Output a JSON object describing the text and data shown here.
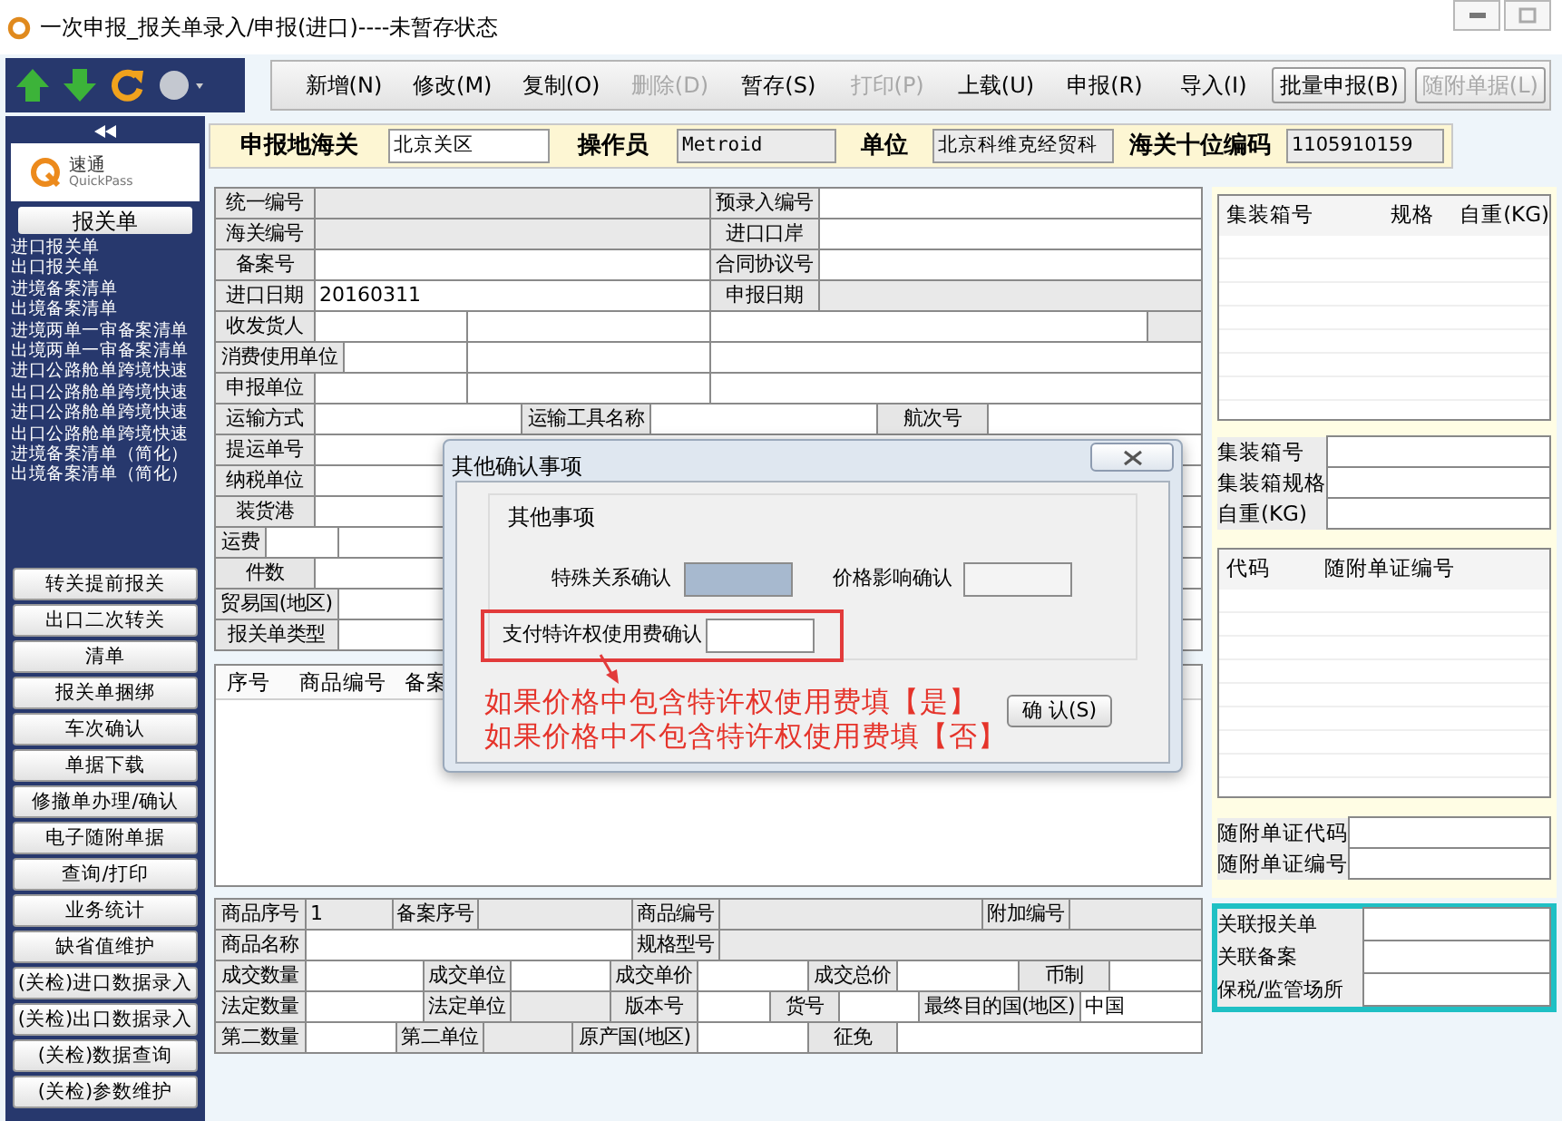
{
  "window": {
    "title": "一次申报_报关单录入/申报(进口)----未暂存状态"
  },
  "toolbar": {
    "buttons": [
      {
        "label": "新增(N)",
        "kind": "flat",
        "disabled": false
      },
      {
        "label": "修改(M)",
        "kind": "flat",
        "disabled": false
      },
      {
        "label": "复制(O)",
        "kind": "flat",
        "disabled": false
      },
      {
        "label": "删除(D)",
        "kind": "flat",
        "disabled": true
      },
      {
        "label": "暂存(S)",
        "kind": "flat",
        "disabled": false
      },
      {
        "label": "打印(P)",
        "kind": "flat",
        "disabled": true
      },
      {
        "label": "上载(U)",
        "kind": "flat",
        "disabled": false
      },
      {
        "label": "申报(R)",
        "kind": "flat",
        "disabled": false
      },
      {
        "label": "导入(I)",
        "kind": "flat",
        "disabled": false
      },
      {
        "label": "批量申报(B)",
        "kind": "raised",
        "disabled": false
      },
      {
        "label": "随附单据(L)",
        "kind": "raised",
        "disabled": true
      }
    ]
  },
  "header": {
    "fields": [
      {
        "label": "申报地海关",
        "value": "北京关区",
        "disabled": false
      },
      {
        "label": "操作员",
        "value": "Metroid",
        "disabled": true
      },
      {
        "label": "单位",
        "value": "北京科维克经贸科",
        "disabled": true
      },
      {
        "label": "海关十位编码",
        "value": "1105910159",
        "disabled": true
      }
    ]
  },
  "sidebar": {
    "logo": {
      "name": "速通",
      "subtitle": "QuickPass"
    },
    "section": "报关单",
    "links": [
      "进口报关单",
      "出口报关单",
      "进境备案清单",
      "出境备案清单",
      "进境两单一审备案清单",
      "出境两单一审备案清单",
      "进口公路舱单跨境快速",
      "出口公路舱单跨境快速",
      "进口公路舱单跨境快速",
      "出口公路舱单跨境快速",
      "进境备案清单（简化）",
      "出境备案清单（简化）"
    ],
    "buttons": [
      "转关提前报关",
      "出口二次转关",
      "清单",
      "报关单捆绑",
      "车次确认",
      "单据下载",
      "修撤单办理/确认",
      "电子随附单据",
      "查询/打印",
      "业务统计",
      "缺省值维护",
      "(关检)进口数据录入",
      "(关检)出口数据录入",
      "(关检)数据查询",
      "(关检)参数维护"
    ]
  },
  "form": {
    "rows": [
      [
        {
          "kind": "label",
          "text": "统一编号"
        },
        {
          "kind": "field",
          "disabled": true
        },
        {
          "kind": "label",
          "text": "预录入编号"
        },
        {
          "kind": "field",
          "disabled": false
        }
      ],
      [
        {
          "kind": "label",
          "text": "海关编号"
        },
        {
          "kind": "field",
          "disabled": true
        },
        {
          "kind": "label",
          "text": "进口口岸"
        },
        {
          "kind": "field",
          "disabled": false
        }
      ],
      [
        {
          "kind": "label",
          "text": "备案号"
        },
        {
          "kind": "field",
          "disabled": false
        },
        {
          "kind": "label",
          "text": "合同协议号"
        },
        {
          "kind": "field",
          "disabled": false
        }
      ],
      [
        {
          "kind": "label",
          "text": "进口日期"
        },
        {
          "kind": "field",
          "value": "20160311",
          "disabled": false
        },
        {
          "kind": "label",
          "text": "申报日期"
        },
        {
          "kind": "field",
          "disabled": true
        }
      ],
      [
        {
          "kind": "label",
          "text": "收发货人"
        },
        {
          "kind": "field",
          "disabled": false
        },
        {
          "kind": "field",
          "disabled": false
        },
        {
          "kind": "field",
          "disabled": false
        },
        {
          "kind": "field",
          "disabled": true
        }
      ],
      [
        {
          "kind": "label",
          "text": "消费使用单位"
        },
        {
          "kind": "field",
          "disabled": false
        },
        {
          "kind": "field",
          "disabled": false
        },
        {
          "kind": "field",
          "disabled": false
        }
      ],
      [
        {
          "kind": "label",
          "text": "申报单位"
        },
        {
          "kind": "field",
          "disabled": false
        },
        {
          "kind": "field",
          "disabled": false
        },
        {
          "kind": "field",
          "disabled": false
        }
      ],
      [
        {
          "kind": "label",
          "text": "运输方式"
        },
        {
          "kind": "field",
          "disabled": false
        },
        {
          "kind": "label",
          "text": "运输工具名称"
        },
        {
          "kind": "field",
          "disabled": false
        },
        {
          "kind": "label",
          "text": "航次号"
        },
        {
          "kind": "field",
          "disabled": false
        }
      ],
      [
        {
          "kind": "label",
          "text": "提运单号"
        },
        {
          "kind": "field",
          "disabled": false
        }
      ],
      [
        {
          "kind": "label",
          "text": "纳税单位"
        },
        {
          "kind": "field",
          "disabled": false
        }
      ],
      [
        {
          "kind": "label",
          "text": "装货港"
        },
        {
          "kind": "field",
          "disabled": false
        }
      ],
      [
        {
          "kind": "label",
          "text": "运费"
        },
        {
          "kind": "field",
          "disabled": false
        },
        {
          "kind": "field",
          "disabled": false
        }
      ],
      [
        {
          "kind": "label",
          "text": "件数"
        },
        {
          "kind": "field",
          "disabled": false
        }
      ],
      [
        {
          "kind": "label",
          "text": "贸易国(地区)"
        },
        {
          "kind": "field",
          "disabled": false
        }
      ],
      [
        {
          "kind": "label",
          "text": "报关单类型"
        },
        {
          "kind": "field",
          "disabled": false
        }
      ]
    ]
  },
  "goods_list": {
    "columns": [
      "序号",
      "商品编号",
      "备案"
    ]
  },
  "goods_form": {
    "lines": [
      {
        "fields": [
          {
            "label": "商品序号",
            "value": "1",
            "disabled": true
          },
          {
            "label": "备案序号",
            "disabled": true
          },
          {
            "label": "商品编号",
            "disabled": true
          },
          {
            "label": "附加编号",
            "disabled": true
          }
        ]
      },
      {
        "fields": [
          {
            "label": "商品名称",
            "disabled": false
          },
          {
            "label": "规格型号",
            "disabled": true
          }
        ]
      },
      {
        "fields": [
          {
            "label": "成交数量",
            "disabled": false
          },
          {
            "label": "成交单位",
            "disabled": false
          },
          {
            "label": "成交单价",
            "disabled": false
          },
          {
            "label": "成交总价",
            "disabled": false
          },
          {
            "label": "币制",
            "disabled": false
          }
        ]
      },
      {
        "fields": [
          {
            "label": "法定数量",
            "disabled": false
          },
          {
            "label": "法定单位",
            "disabled": true
          },
          {
            "label": "版本号",
            "disabled": false
          },
          {
            "label": "货号",
            "disabled": false
          },
          {
            "label": "最终目的国(地区)",
            "value": "中国",
            "disabled": false
          }
        ]
      },
      {
        "fields": [
          {
            "label": "第二数量",
            "disabled": false
          },
          {
            "label": "第二单位",
            "disabled": true
          },
          {
            "label": "原产国(地区)",
            "disabled": false
          },
          {
            "label": "征免",
            "disabled": false
          }
        ]
      }
    ]
  },
  "dialog": {
    "title": "其他确认事项",
    "group_title": "其他事项",
    "fields": [
      {
        "label": "特殊关系确认",
        "focused": true,
        "highlighted": false
      },
      {
        "label": "价格影响确认",
        "focused": false,
        "highlighted": false
      },
      {
        "label": "支付特许权使用费确认",
        "focused": false,
        "highlighted": true
      }
    ],
    "notes": [
      "如果价格中包含特许权使用费填【是】",
      "如果价格中不包含特许权使用费填【否】"
    ],
    "button": "确 认(S)"
  },
  "right_panel": {
    "container_table": {
      "columns": [
        "集装箱号",
        "规格",
        "自重(KG)"
      ]
    },
    "container_fields": [
      "集装箱号",
      "集装箱规格",
      "自重(KG)"
    ],
    "document_table": {
      "columns": [
        "代码",
        "随附单证编号"
      ]
    },
    "document_fields": [
      "随附单证代码",
      "随附单证编号"
    ],
    "related_fields": [
      "关联报关单",
      "关联备案",
      "保税/监管场所"
    ]
  }
}
